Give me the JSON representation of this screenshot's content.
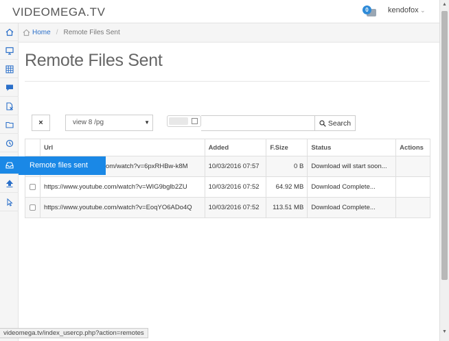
{
  "header": {
    "brand": "VIDEOMEGA.TV",
    "notification_count": "0",
    "username": "kendofox"
  },
  "sidebar": {
    "items": [
      {
        "icon": "home-icon"
      },
      {
        "icon": "monitor-icon"
      },
      {
        "icon": "grid-icon"
      },
      {
        "icon": "chat-icon"
      },
      {
        "icon": "file-x-icon"
      },
      {
        "icon": "folder-icon"
      },
      {
        "icon": "refresh-icon"
      },
      {
        "icon": "inbox-icon"
      },
      {
        "icon": "upload-icon"
      },
      {
        "icon": "cursor-icon"
      }
    ],
    "flyout_label": "Remote files sent"
  },
  "breadcrumb": {
    "home": "Home",
    "current": "Remote Files Sent"
  },
  "page": {
    "title": "Remote Files Sent"
  },
  "toolbar": {
    "close_label": "×",
    "per_page_selected": "view 8 /pg",
    "search_placeholder": "",
    "search_label": "Search"
  },
  "table": {
    "headers": {
      "url": "Url",
      "added": "Added",
      "size": "F.Size",
      "status": "Status",
      "actions": "Actions"
    },
    "rows": [
      {
        "url": "https://www.youtube.com/watch?v=6pxRHBw-k8M",
        "url_visible": "om/watch?v=6pxRHBw-k8M",
        "added": "10/03/2016 07:57",
        "size": "0 B",
        "status": "Download will start soon..."
      },
      {
        "url": "https://www.youtube.com/watch?v=WIG9bglb2ZU",
        "added": "10/03/2016 07:52",
        "size": "64.92 MB",
        "status": "Download Complete..."
      },
      {
        "url": "https://www.youtube.com/watch?v=EoqYO6ADo4Q",
        "added": "10/03/2016 07:52",
        "size": "113.51 MB",
        "status": "Download Complete..."
      }
    ]
  },
  "status_bar": {
    "url": "videomega.tv/index_usercp.php?action=remotes"
  },
  "colors": {
    "accent": "#1a88e6",
    "link": "#2a6fc9",
    "badge": "#2f8bd8"
  }
}
